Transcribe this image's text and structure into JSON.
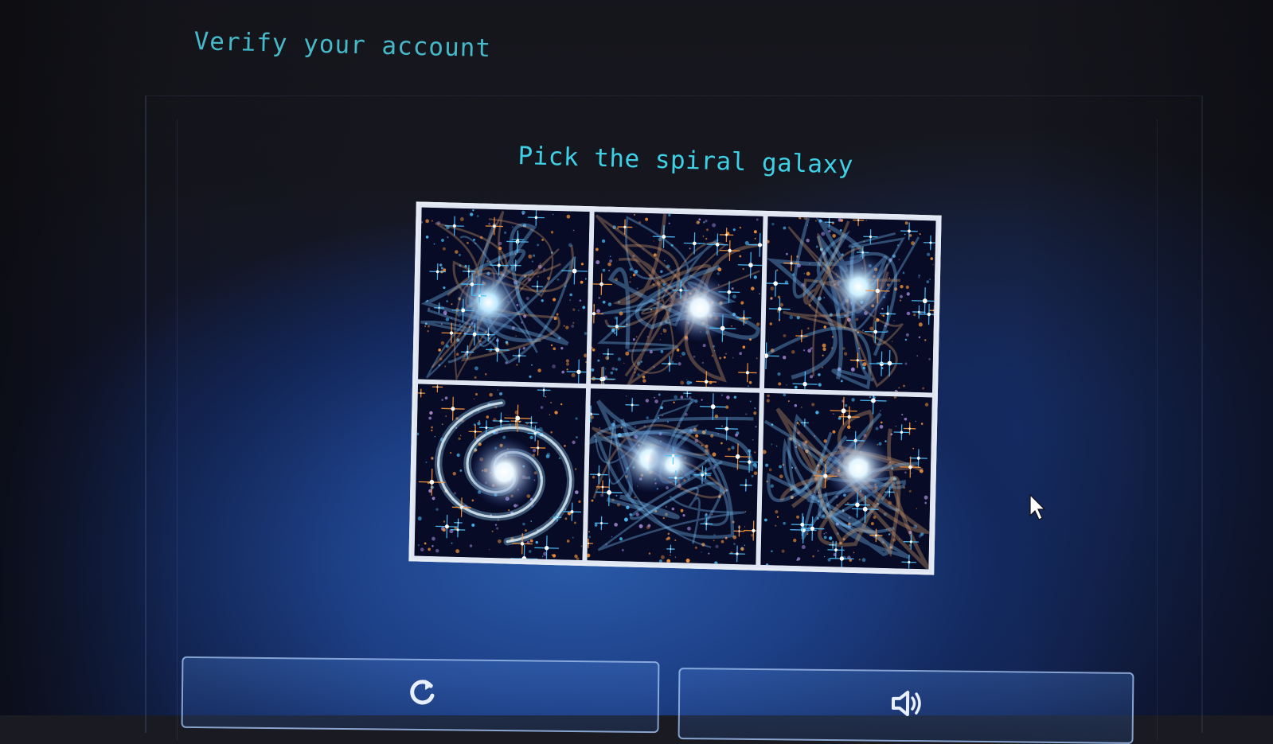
{
  "header": {
    "title": "Verify your account"
  },
  "captcha": {
    "prompt": "Pick the spiral galaxy",
    "tiles": [
      {
        "label": "galaxy-tile-1",
        "kind": "irregular",
        "core": "#bfe9ff",
        "accent": "#ff9a3c"
      },
      {
        "label": "galaxy-tile-2",
        "kind": "irregular",
        "core": "#e8f6ff",
        "accent": "#ffb04a"
      },
      {
        "label": "galaxy-tile-3",
        "kind": "irregular",
        "core": "#cdefff",
        "accent": "#ff8e3a"
      },
      {
        "label": "galaxy-tile-4",
        "kind": "spiral",
        "core": "#eaf7ff",
        "accent": "#ff9d45"
      },
      {
        "label": "galaxy-tile-5",
        "kind": "irregular",
        "core": "#d9f3ff",
        "accent": "#ffa552"
      },
      {
        "label": "galaxy-tile-6",
        "kind": "irregular",
        "core": "#e2f5ff",
        "accent": "#ff9440"
      }
    ]
  },
  "controls": {
    "refresh_icon": "refresh-icon",
    "audio_icon": "speaker-icon"
  },
  "colors": {
    "title": "#46b8c8",
    "prompt": "#3fd0e6",
    "star_blue": "#4fc3ff",
    "star_orange": "#ff9a3c"
  }
}
